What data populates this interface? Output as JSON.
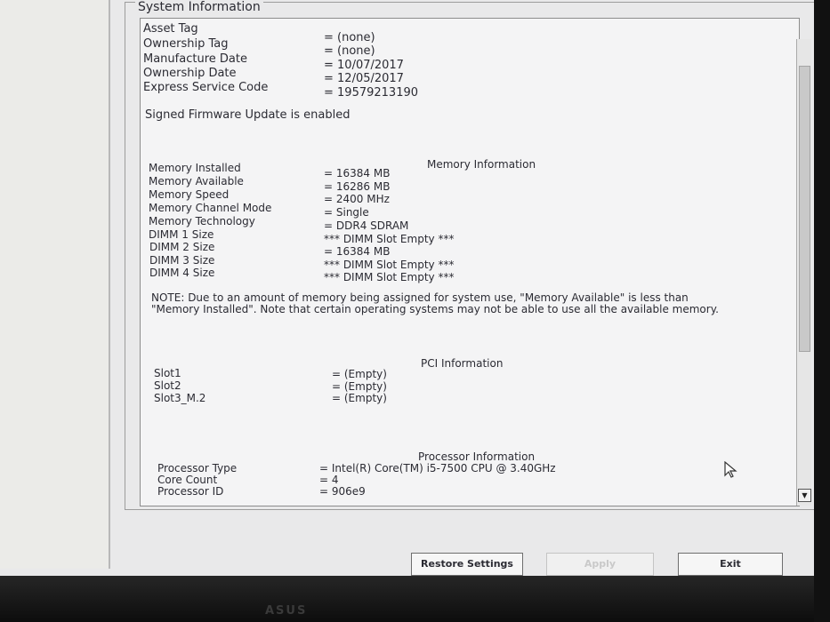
{
  "group_title": "System Information",
  "system": [
    {
      "label": "Asset Tag",
      "value": "= (none)"
    },
    {
      "label": "Ownership Tag",
      "value": "= (none)"
    },
    {
      "label": "Manufacture Date",
      "value": "= 10/07/2017"
    },
    {
      "label": "Ownership Date",
      "value": "= 12/05/2017"
    },
    {
      "label": "Express Service Code",
      "value": "= 19579213190"
    }
  ],
  "signed_firmware": "Signed Firmware Update is enabled",
  "memory": {
    "title": "Memory Information",
    "rows": [
      {
        "label": "Memory Installed",
        "value": "= 16384 MB"
      },
      {
        "label": "Memory Available",
        "value": "= 16286 MB"
      },
      {
        "label": "Memory Speed",
        "value": "= 2400 MHz"
      },
      {
        "label": "Memory Channel Mode",
        "value": "= Single"
      },
      {
        "label": "Memory Technology",
        "value": "= DDR4 SDRAM"
      },
      {
        "label": "DIMM 1 Size",
        "value": "*** DIMM Slot Empty ***"
      },
      {
        "label": "DIMM 2 Size",
        "value": "= 16384 MB"
      },
      {
        "label": "DIMM 3 Size",
        "value": "*** DIMM Slot Empty ***"
      },
      {
        "label": "DIMM 4 Size",
        "value": "*** DIMM Slot Empty ***"
      }
    ],
    "note": "NOTE: Due to an amount of memory being assigned for system use, \"Memory Available\" is less than \"Memory Installed\". Note that certain operating systems may not be able to use all the available memory."
  },
  "pci": {
    "title": "PCI Information",
    "rows": [
      {
        "label": "Slot1",
        "value": "= (Empty)"
      },
      {
        "label": "Slot2",
        "value": "= (Empty)"
      },
      {
        "label": "Slot3_M.2",
        "value": "= (Empty)"
      }
    ]
  },
  "processor": {
    "title": "Processor Information",
    "rows": [
      {
        "label": "Processor Type",
        "value": "= Intel(R) Core(TM) i5-7500 CPU @ 3.40GHz"
      },
      {
        "label": "Core Count",
        "value": "= 4"
      },
      {
        "label": "Processor ID",
        "value": "= 906e9"
      }
    ]
  },
  "buttons": {
    "restore": "Restore Settings",
    "apply": "Apply",
    "exit": "Exit"
  },
  "bezel_logo": "ASUS",
  "icons": {
    "scroll_down": "scroll-down-arrow-icon",
    "cursor": "mouse-pointer-icon"
  }
}
